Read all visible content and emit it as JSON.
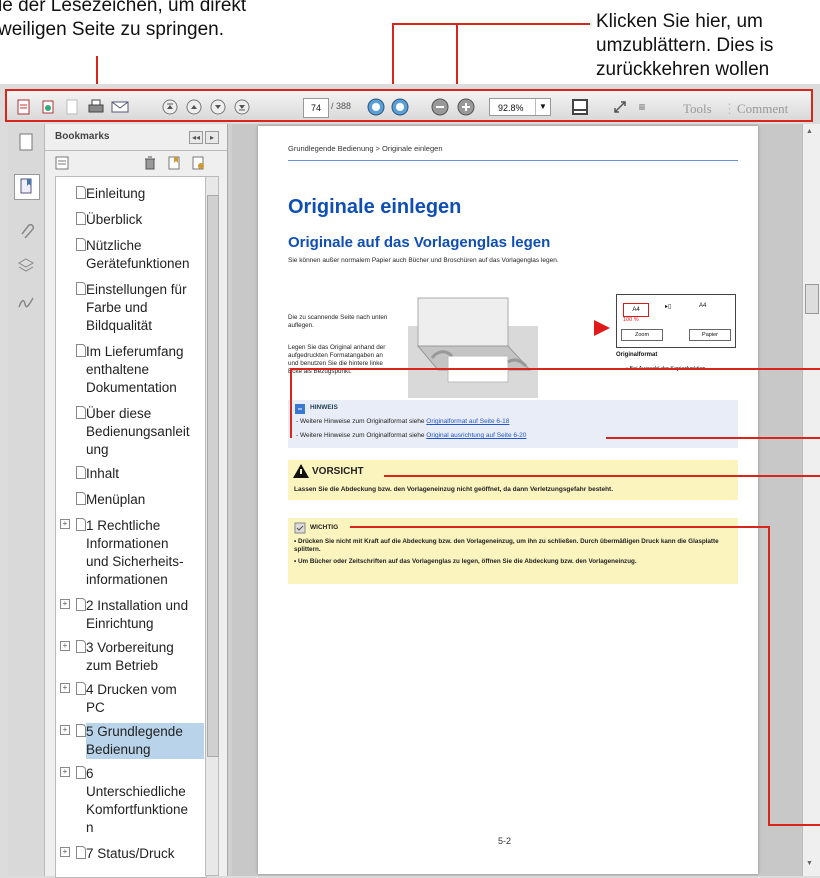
{
  "annotations": {
    "top_left_line1": "le der Lesezeichen, um direkt",
    "top_left_line2": "weiligen Seite zu springen.",
    "top_right_line1": "Klicken Sie hier, um",
    "top_right_line2": "umzublättern. Dies is",
    "top_right_line3": "zurückkehren wollen"
  },
  "colors": {
    "annotation_red": "#d9261c",
    "heading_blue": "#0f4fb3",
    "selection_blue": "#b8d3ea",
    "note_yellow": "#fbf4bf",
    "note_blue": "#e8edf7"
  },
  "toolbar": {
    "icons": [
      "create-pdf-icon",
      "combine-icon",
      "edit-doc-icon",
      "print-icon",
      "email-icon",
      "first-page-icon",
      "previous-page-icon",
      "next-page-icon",
      "last-page-icon",
      "back-view-icon",
      "forward-view-icon",
      "zoom-out-icon",
      "zoom-in-icon",
      "fit-page-icon",
      "expand-icon",
      "menu-icon"
    ],
    "page_current": "74",
    "page_total": "/ 388",
    "zoom_value": "92.8%",
    "tools_label": "Tools",
    "comment_label": "Comment"
  },
  "side_panel": {
    "title": "Bookmarks",
    "rail_icons": [
      "pages-icon",
      "bookmark-icon",
      "attachment-icon",
      "layers-icon",
      "signature-icon"
    ],
    "bookmarks": [
      {
        "label": "Einleitung",
        "expandable": false,
        "selected": false
      },
      {
        "label": "Überblick",
        "expandable": false,
        "selected": false
      },
      {
        "label": "Nützliche\nGerätefunktionen",
        "expandable": false,
        "selected": false
      },
      {
        "label": "Einstellungen für\nFarbe und\nBildqualität",
        "expandable": false,
        "selected": false
      },
      {
        "label": "Im Lieferumfang\nenthaltene\nDokumentation",
        "expandable": false,
        "selected": false
      },
      {
        "label": "Über diese\nBedienungsanleit\nung",
        "expandable": false,
        "selected": false
      },
      {
        "label": "Inhalt",
        "expandable": false,
        "selected": false
      },
      {
        "label": "Menüplan",
        "expandable": false,
        "selected": false
      },
      {
        "label": "1 Rechtliche\nInformationen\nund Sicherheits-\ninformationen",
        "expandable": true,
        "selected": false
      },
      {
        "label": "2 Installation und\nEinrichtung",
        "expandable": true,
        "selected": false
      },
      {
        "label": "3 Vorbereitung\nzum Betrieb",
        "expandable": true,
        "selected": false
      },
      {
        "label": "4 Drucken vom\nPC",
        "expandable": true,
        "selected": false
      },
      {
        "label": "5 Grundlegende\nBedienung",
        "expandable": true,
        "selected": true
      },
      {
        "label": "6\nUnterschiedliche\nKomfortfunktione\nn",
        "expandable": true,
        "selected": false
      },
      {
        "label": "7 Status/Druck",
        "expandable": true,
        "selected": false
      }
    ]
  },
  "document": {
    "breadcrumb": "Grundlegende Bedienung > Originale einlegen",
    "title": "Originale einlegen",
    "subtitle": "Originale auf das Vorlagenglas legen",
    "intro": "Sie können außer normalem Papier auch Bücher und Broschüren auf das Vorlagenglas legen.",
    "caption_1": "Die zu scannende Seite nach unten\nauflegen.",
    "caption_2": "Legen Sie das Original anhand der\naufgedruckten Formatangaben an\nund benutzen Sie die hintere linke\nEcke als Bezugspunkt.",
    "panel_labels": {
      "a4": "A4",
      "zoom": "Zoom",
      "percent": "100 %",
      "paper": "Papier",
      "original_format": "Originalformat",
      "bullet": "Bei Auswahl der Kopierfunktion"
    },
    "note": {
      "title": "HINWEIS",
      "line1_prefix": "- Weitere Hinweise zum Originalformat siehe ",
      "line1_link": "Originalformat auf Seite 6-18",
      "line2_prefix": "- Weitere Hinweise zum Originalformat siehe ",
      "line2_link": "Original ausrichtung auf Seite 6-20"
    },
    "caution": {
      "title": "VORSICHT",
      "text": "Lassen Sie die Abdeckung bzw. den Vorlageneinzug nicht geöffnet, da dann Verletzungsgefahr besteht."
    },
    "important": {
      "title": "WICHTIG",
      "line1": "• Drücken Sie nicht mit Kraft auf die Abdeckung bzw. den Vorlageneinzug, um ihn zu schließen. Durch übermäßigen Druck kann die Glasplatte splittern.",
      "line2": "• Um Bücher oder Zeitschriften auf das Vorlagenglas zu legen, öffnen Sie die Abdeckung bzw. den Vorlageneinzug."
    },
    "page_number": "5-2"
  }
}
